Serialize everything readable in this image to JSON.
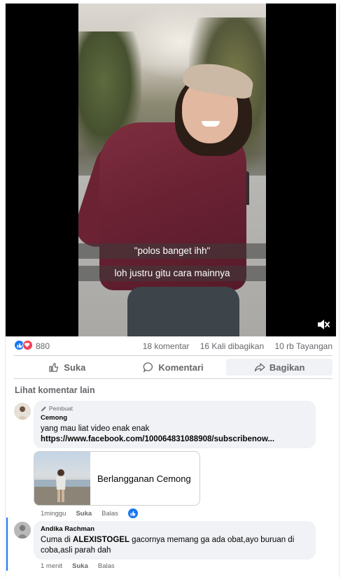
{
  "video": {
    "subtitle_1": "\"polos banget ihh\"",
    "subtitle_2": "loh justru gitu cara mainnya",
    "mute_icon": "volume-muted-icon"
  },
  "stats": {
    "reactions_count": "880",
    "comments": "18 komentar",
    "shares": "16 Kali dibagikan",
    "views": "10 rb Tayangan",
    "reaction_colors": {
      "like": "#1877f2",
      "love": "#f33e58"
    }
  },
  "actions": {
    "like": "Suka",
    "comment": "Komentari",
    "share": "Bagikan"
  },
  "more_comments": "Lihat komentar lain",
  "comments": [
    {
      "badge": "Pembuat",
      "author": "Cemong",
      "line1": "yang mau liat video enak enak",
      "line2": "https://www.facebook.com/100064831088908/subscribenow...",
      "preview_title": "Berlangganan Cemong",
      "time": "1minggu",
      "like": "Suka",
      "reply": "Balas",
      "reaction_icon": "like-icon"
    },
    {
      "author": "Andika Rachman",
      "text_before": "Cuma di ",
      "text_bold": "ALEXISTOGEL",
      "text_after": " gacornya memang ga ada obat,ayo buruan di coba,asli parah dah",
      "time": "1 menit",
      "like": "Suka",
      "reply": "Balas"
    }
  ],
  "colors": {
    "accent": "#1877f2",
    "muted_text": "#65676b",
    "bubble_bg": "#f0f2f5"
  }
}
